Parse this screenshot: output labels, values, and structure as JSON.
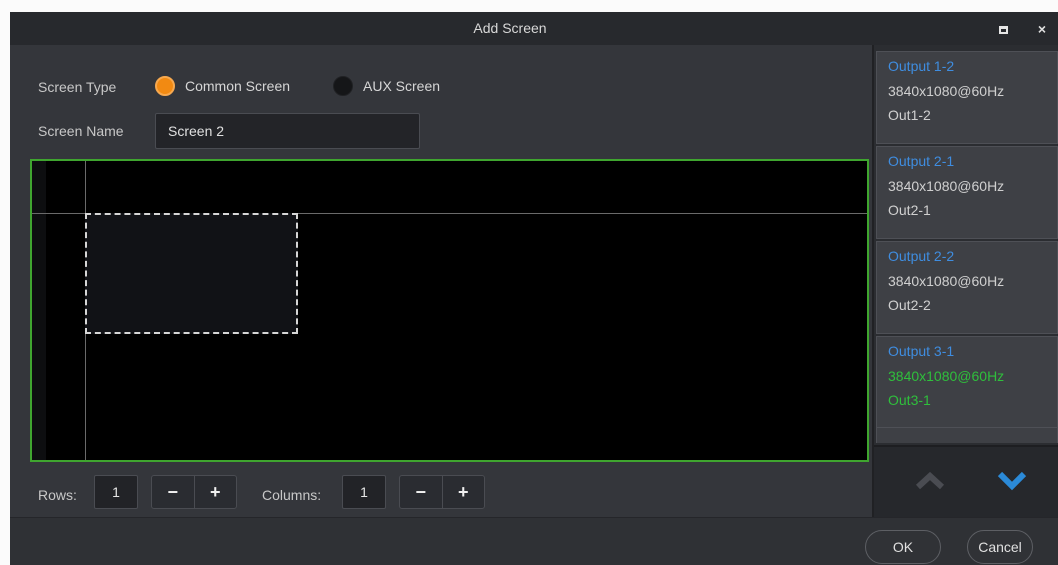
{
  "window": {
    "title": "Add Screen",
    "maximize_icon": "maximize-icon",
    "close_label": "×"
  },
  "form": {
    "screen_type_label": "Screen Type",
    "radio_common": {
      "label": "Common Screen",
      "selected": true,
      "color": "#f28a12"
    },
    "radio_aux": {
      "label": "AUX Screen",
      "selected": false
    },
    "screen_name_label": "Screen Name",
    "screen_name_value": "Screen 2"
  },
  "canvas": {
    "border_color": "#3fa52f"
  },
  "grid_controls": {
    "rows_label": "Rows:",
    "rows_value": "1",
    "columns_label": "Columns:",
    "columns_value": "1",
    "minus": "−",
    "plus": "+"
  },
  "outputs": [
    {
      "name": "Output 1-2",
      "resolution": "3840x1080@60Hz",
      "port": "Out1-2",
      "active": false
    },
    {
      "name": "Output 2-1",
      "resolution": "3840x1080@60Hz",
      "port": "Out2-1",
      "active": false
    },
    {
      "name": "Output 2-2",
      "resolution": "3840x1080@60Hz",
      "port": "Out2-2",
      "active": false
    },
    {
      "name": "Output 3-1",
      "resolution": "3840x1080@60Hz",
      "port": "Out3-1",
      "active": true
    }
  ],
  "nav": {
    "up_icon": "chevron-up-icon",
    "down_icon": "chevron-down-icon",
    "down_color": "#2b8ad8"
  },
  "footer": {
    "ok_label": "OK",
    "cancel_label": "Cancel"
  }
}
